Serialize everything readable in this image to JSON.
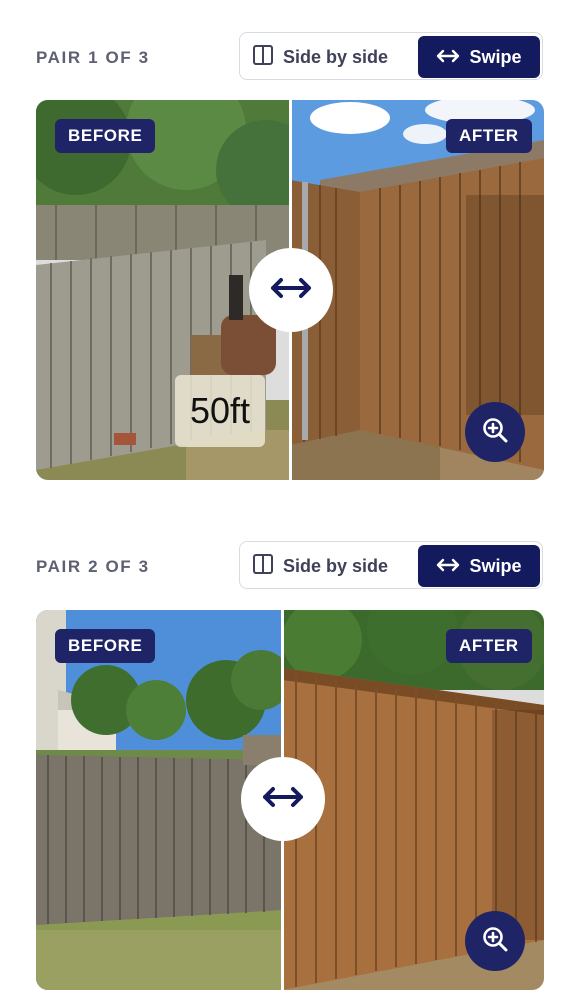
{
  "pairs": [
    {
      "header": "PAIR 1 OF 3",
      "toggle": {
        "side_by_side": "Side by side",
        "swipe": "Swipe",
        "active": "swipe"
      },
      "before_badge": "BEFORE",
      "after_badge": "AFTER",
      "overlay_text": "50ft",
      "handle_icon": "left-right-arrow-icon",
      "zoom_icon": "zoom-in-icon"
    },
    {
      "header": "PAIR 2 OF 3",
      "toggle": {
        "side_by_side": "Side by side",
        "swipe": "Swipe",
        "active": "swipe"
      },
      "before_badge": "BEFORE",
      "after_badge": "AFTER",
      "handle_icon": "left-right-arrow-icon",
      "zoom_icon": "zoom-in-icon"
    }
  ],
  "colors": {
    "accent": "#141a5e",
    "badge": "#1f2466",
    "label": "#5d5f73"
  }
}
